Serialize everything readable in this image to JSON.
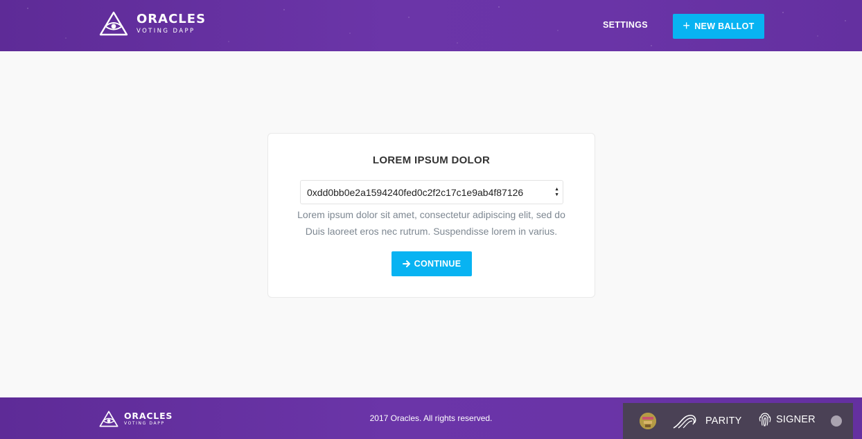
{
  "header": {
    "logo_title": "ORACLES",
    "logo_subtitle": "VOTING DAPP",
    "settings_label": "SETTINGS",
    "new_ballot_label": "NEW BALLOT"
  },
  "card": {
    "title": "LOREM IPSUM DOLOR",
    "selected_address": "0xdd0bb0e2a1594240fed0c2f2c17c1e9ab4f87126",
    "description_line1": "Lorem ipsum dolor sit amet, consectetur adipiscing elit, sed do",
    "description_line2": "Duis laoreet eros nec rutrum. Suspendisse lorem in varius.",
    "continue_label": "CONTINUE"
  },
  "footer": {
    "logo_title": "ORACLES",
    "logo_subtitle": "VOTING DAPP",
    "copyright": "2017 Oracles. All rights reserved."
  },
  "parity_bar": {
    "brand_label": "PARITY",
    "signer_label": "SIGNER"
  },
  "colors": {
    "header_purple": "#6b35a8",
    "accent_blue": "#08b3f2",
    "parity_bar": "#4a4155"
  },
  "icons": {
    "logo": "eye-triangle-icon",
    "new_ballot": "plus-icon",
    "continue": "arrow-right-icon",
    "select": "select-arrows-icon",
    "parity": "parity-logo-icon",
    "signer": "fingerprint-icon"
  }
}
